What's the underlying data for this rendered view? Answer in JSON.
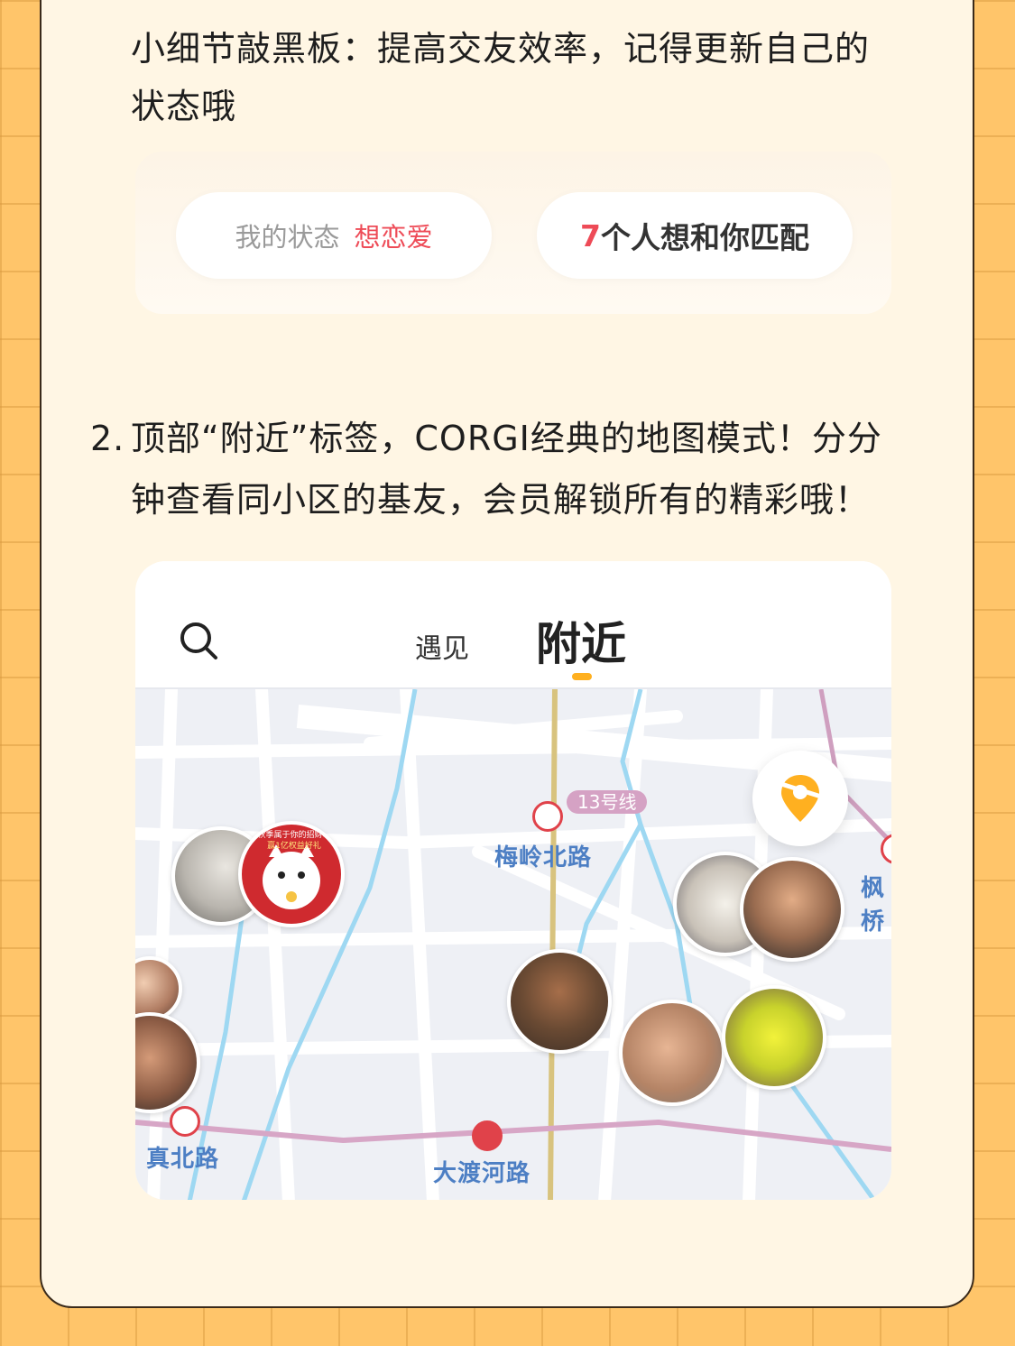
{
  "tip": {
    "text_line1": "小细节敲黑板：提高交友效率，记得更新自己的",
    "text_line2": "状态哦"
  },
  "status_panel": {
    "status_label": "我的状态",
    "status_value": "想恋爱",
    "match_count": "7",
    "match_text": "个人想和你匹配"
  },
  "point2": {
    "number": "2.",
    "line1": "顶部“附近”标签，CORGI经典的地图模式！分分",
    "line2": "钟查看同小区的基友，会员解锁所有的精彩哦！"
  },
  "app": {
    "tab_meet": "遇见",
    "tab_nearby": "附近",
    "search_icon": "search-icon",
    "locate_icon": "location-pin-icon",
    "accent_color": "#ffb020",
    "alert_color": "#ee4b57"
  },
  "map": {
    "stations": [
      "梅岭北路",
      "枫桥",
      "真北路",
      "大渡河路"
    ],
    "line_badge": "13号线",
    "promo_line1": "秋季属于你的招财喵",
    "promo_line2": "赢1亿权益好礼"
  }
}
